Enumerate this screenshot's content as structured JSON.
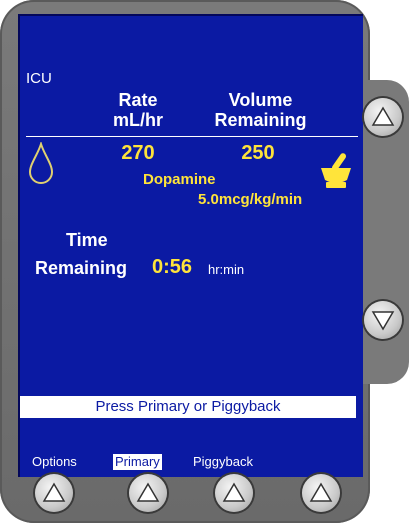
{
  "screen": {
    "location": "ICU",
    "headers": {
      "rate_line1": "Rate",
      "rate_line2": "mL/hr",
      "volume_line1": "Volume",
      "volume_line2": "Remaining"
    },
    "rate_value": "270",
    "volume_value": "250",
    "drug_name": "Dopamine",
    "dose": "5.0mcg/kg/min",
    "time": {
      "label_line1": "Time",
      "label_line2": "Remaining",
      "value": "0:56",
      "unit": "hr:min"
    },
    "prompt": "Press Primary or Piggyback",
    "softkeys": [
      "Options",
      "Primary",
      "Piggyback"
    ],
    "selected_softkey": "Primary"
  },
  "icons": {
    "drop": "drop-icon",
    "drug": "mortar-pestle-icon",
    "up": "arrow-up-icon",
    "down": "arrow-down-icon"
  },
  "colors": {
    "screen_bg": "#0b1aa3",
    "text": "#ffffff",
    "highlight": "#ffe43a",
    "bezel": "#7a7a7a"
  }
}
